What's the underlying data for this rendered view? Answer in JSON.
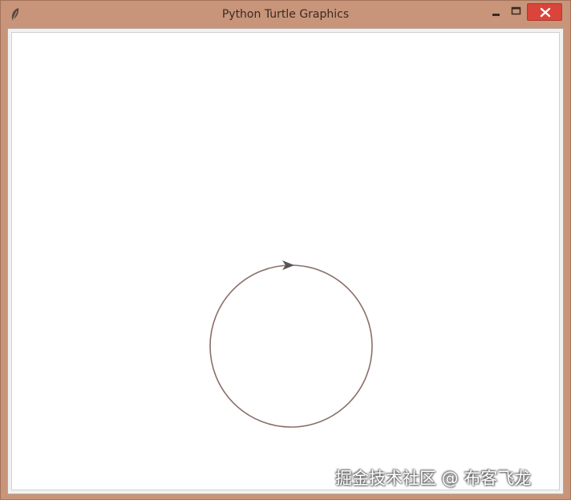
{
  "window": {
    "title": "Python Turtle Graphics",
    "icon": "feather-icon",
    "controls": {
      "minimize_icon": "minimize-icon",
      "maximize_icon": "maximize-icon",
      "close_icon": "close-icon"
    },
    "colors": {
      "frame": "#c8957a",
      "close_button": "#d9453a",
      "canvas": "#ffffff"
    }
  },
  "canvas": {
    "drawing": {
      "shape": "circle",
      "pen_color": "#8a7068",
      "turtle_icon": "turtle-arrow-icon",
      "turtle_color": "#555555"
    }
  },
  "watermark": {
    "text": "掘金技术社区 @ 布客飞龙"
  }
}
